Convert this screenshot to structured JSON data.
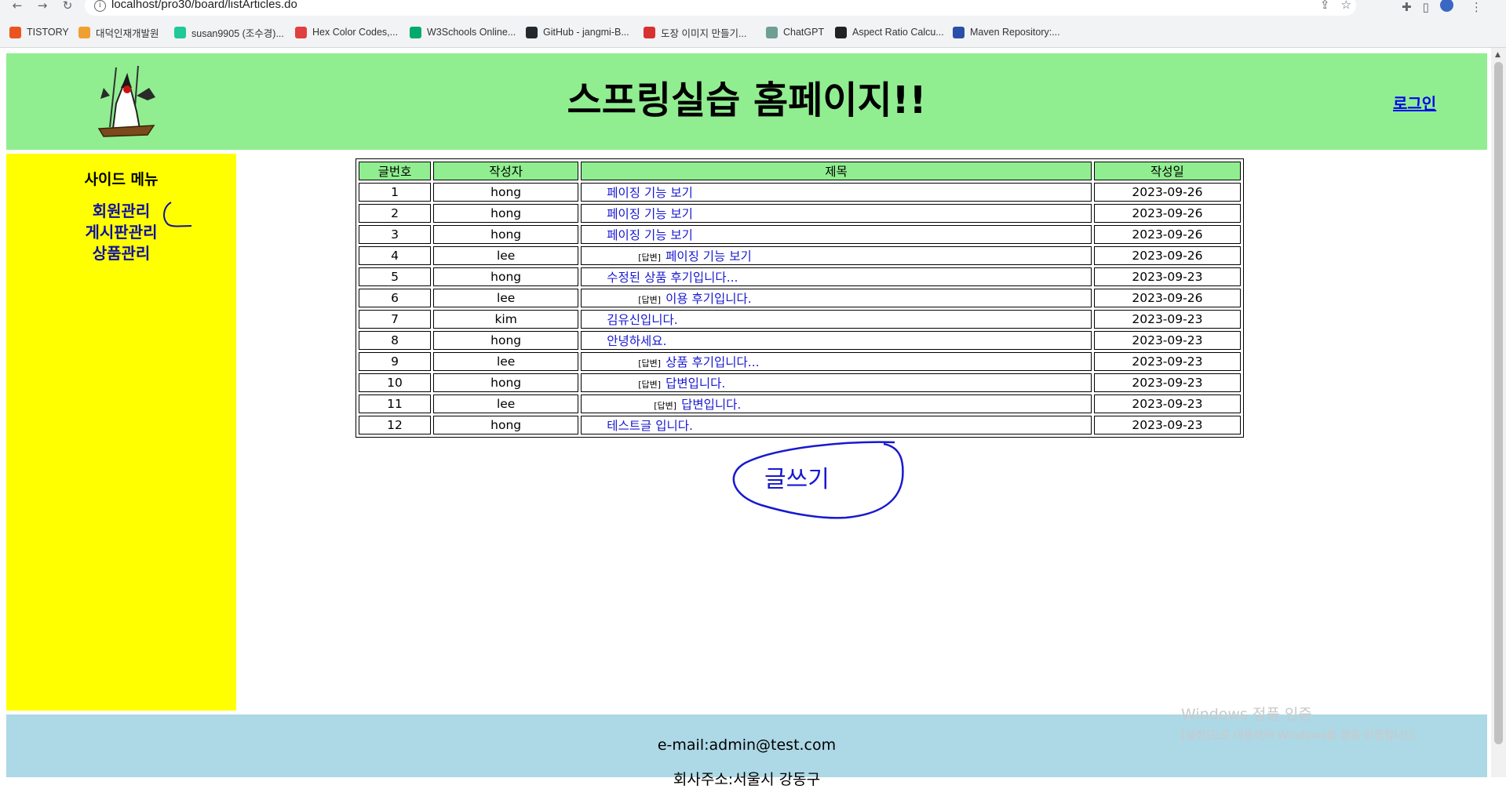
{
  "browser": {
    "url": "localhost/pro30/board/listArticles.do",
    "nav_icons": [
      "back-arrow-icon",
      "forward-arrow-icon",
      "reload-icon"
    ],
    "bookmarks": [
      {
        "label": "TISTORY",
        "icon": "tistory-icon",
        "color": "#eb531f"
      },
      {
        "label": "대덕인재개발원",
        "icon": "ddit-icon",
        "color": "#f0a030"
      },
      {
        "label": "susan9905 (조수경)...",
        "icon": "velog-icon",
        "color": "#20c997"
      },
      {
        "label": "Hex Color Codes,...",
        "icon": "hex-color-icon",
        "color": "#e04040"
      },
      {
        "label": "W3Schools Online...",
        "icon": "w3schools-icon",
        "color": "#04aa6d"
      },
      {
        "label": "GitHub - jangmi-B...",
        "icon": "github-icon",
        "color": "#24292e"
      },
      {
        "label": "도장 이미지 만들기...",
        "icon": "stamp-icon",
        "color": "#d93030"
      },
      {
        "label": "ChatGPT",
        "icon": "chatgpt-icon",
        "color": "#6e9f92"
      },
      {
        "label": "Aspect Ratio Calcu...",
        "icon": "aspect-ratio-icon",
        "color": "#222222"
      },
      {
        "label": "Maven Repository:...",
        "icon": "maven-icon",
        "color": "#2a4fa8"
      }
    ]
  },
  "header": {
    "title": "스프링실습 홈페이지!!",
    "login_label": "로그인",
    "bg_color": "#90ee90"
  },
  "sidebar": {
    "title": "사이드 메뉴",
    "items": [
      {
        "label": "회원관리"
      },
      {
        "label": "게시판관리"
      },
      {
        "label": "상품관리"
      }
    ],
    "bg_color": "#ffff00"
  },
  "board": {
    "columns": [
      "글번호",
      "작성자",
      "제목",
      "작성일"
    ],
    "reply_tag": "[답변]",
    "rows": [
      {
        "no": "1",
        "writer": "hong",
        "title": "페이징 기능 보기",
        "date": "2023-09-26",
        "level": 0
      },
      {
        "no": "2",
        "writer": "hong",
        "title": "페이징 기능 보기",
        "date": "2023-09-26",
        "level": 0
      },
      {
        "no": "3",
        "writer": "hong",
        "title": "페이징 기능 보기",
        "date": "2023-09-26",
        "level": 0
      },
      {
        "no": "4",
        "writer": "lee",
        "title": "페이징 기능 보기",
        "date": "2023-09-26",
        "level": 1
      },
      {
        "no": "5",
        "writer": "hong",
        "title": "수정된 상품 후기입니다...",
        "date": "2023-09-23",
        "level": 0
      },
      {
        "no": "6",
        "writer": "lee",
        "title": "이용 후기입니다.",
        "date": "2023-09-26",
        "level": 1
      },
      {
        "no": "7",
        "writer": "kim",
        "title": "김유신입니다.",
        "date": "2023-09-23",
        "level": 0
      },
      {
        "no": "8",
        "writer": "hong",
        "title": "안녕하세요.",
        "date": "2023-09-23",
        "level": 0
      },
      {
        "no": "9",
        "writer": "lee",
        "title": "상품 후기입니다...",
        "date": "2023-09-23",
        "level": 1
      },
      {
        "no": "10",
        "writer": "hong",
        "title": "답변입니다.",
        "date": "2023-09-23",
        "level": 1
      },
      {
        "no": "11",
        "writer": "lee",
        "title": "답변입니다.",
        "date": "2023-09-23",
        "level": 2
      },
      {
        "no": "12",
        "writer": "hong",
        "title": "테스트글 입니다.",
        "date": "2023-09-23",
        "level": 0
      }
    ],
    "write_label": "글쓰기",
    "link_color": "#1818d0"
  },
  "footer": {
    "email": "e-mail:admin@test.com",
    "address": "회사주소:서울시 강동구",
    "bg_color": "#add8e6"
  },
  "watermark": {
    "line1": "Windows 정품 인증",
    "line2": "[설정]으로 이동하여 Windows를 정품 인증합니다."
  }
}
